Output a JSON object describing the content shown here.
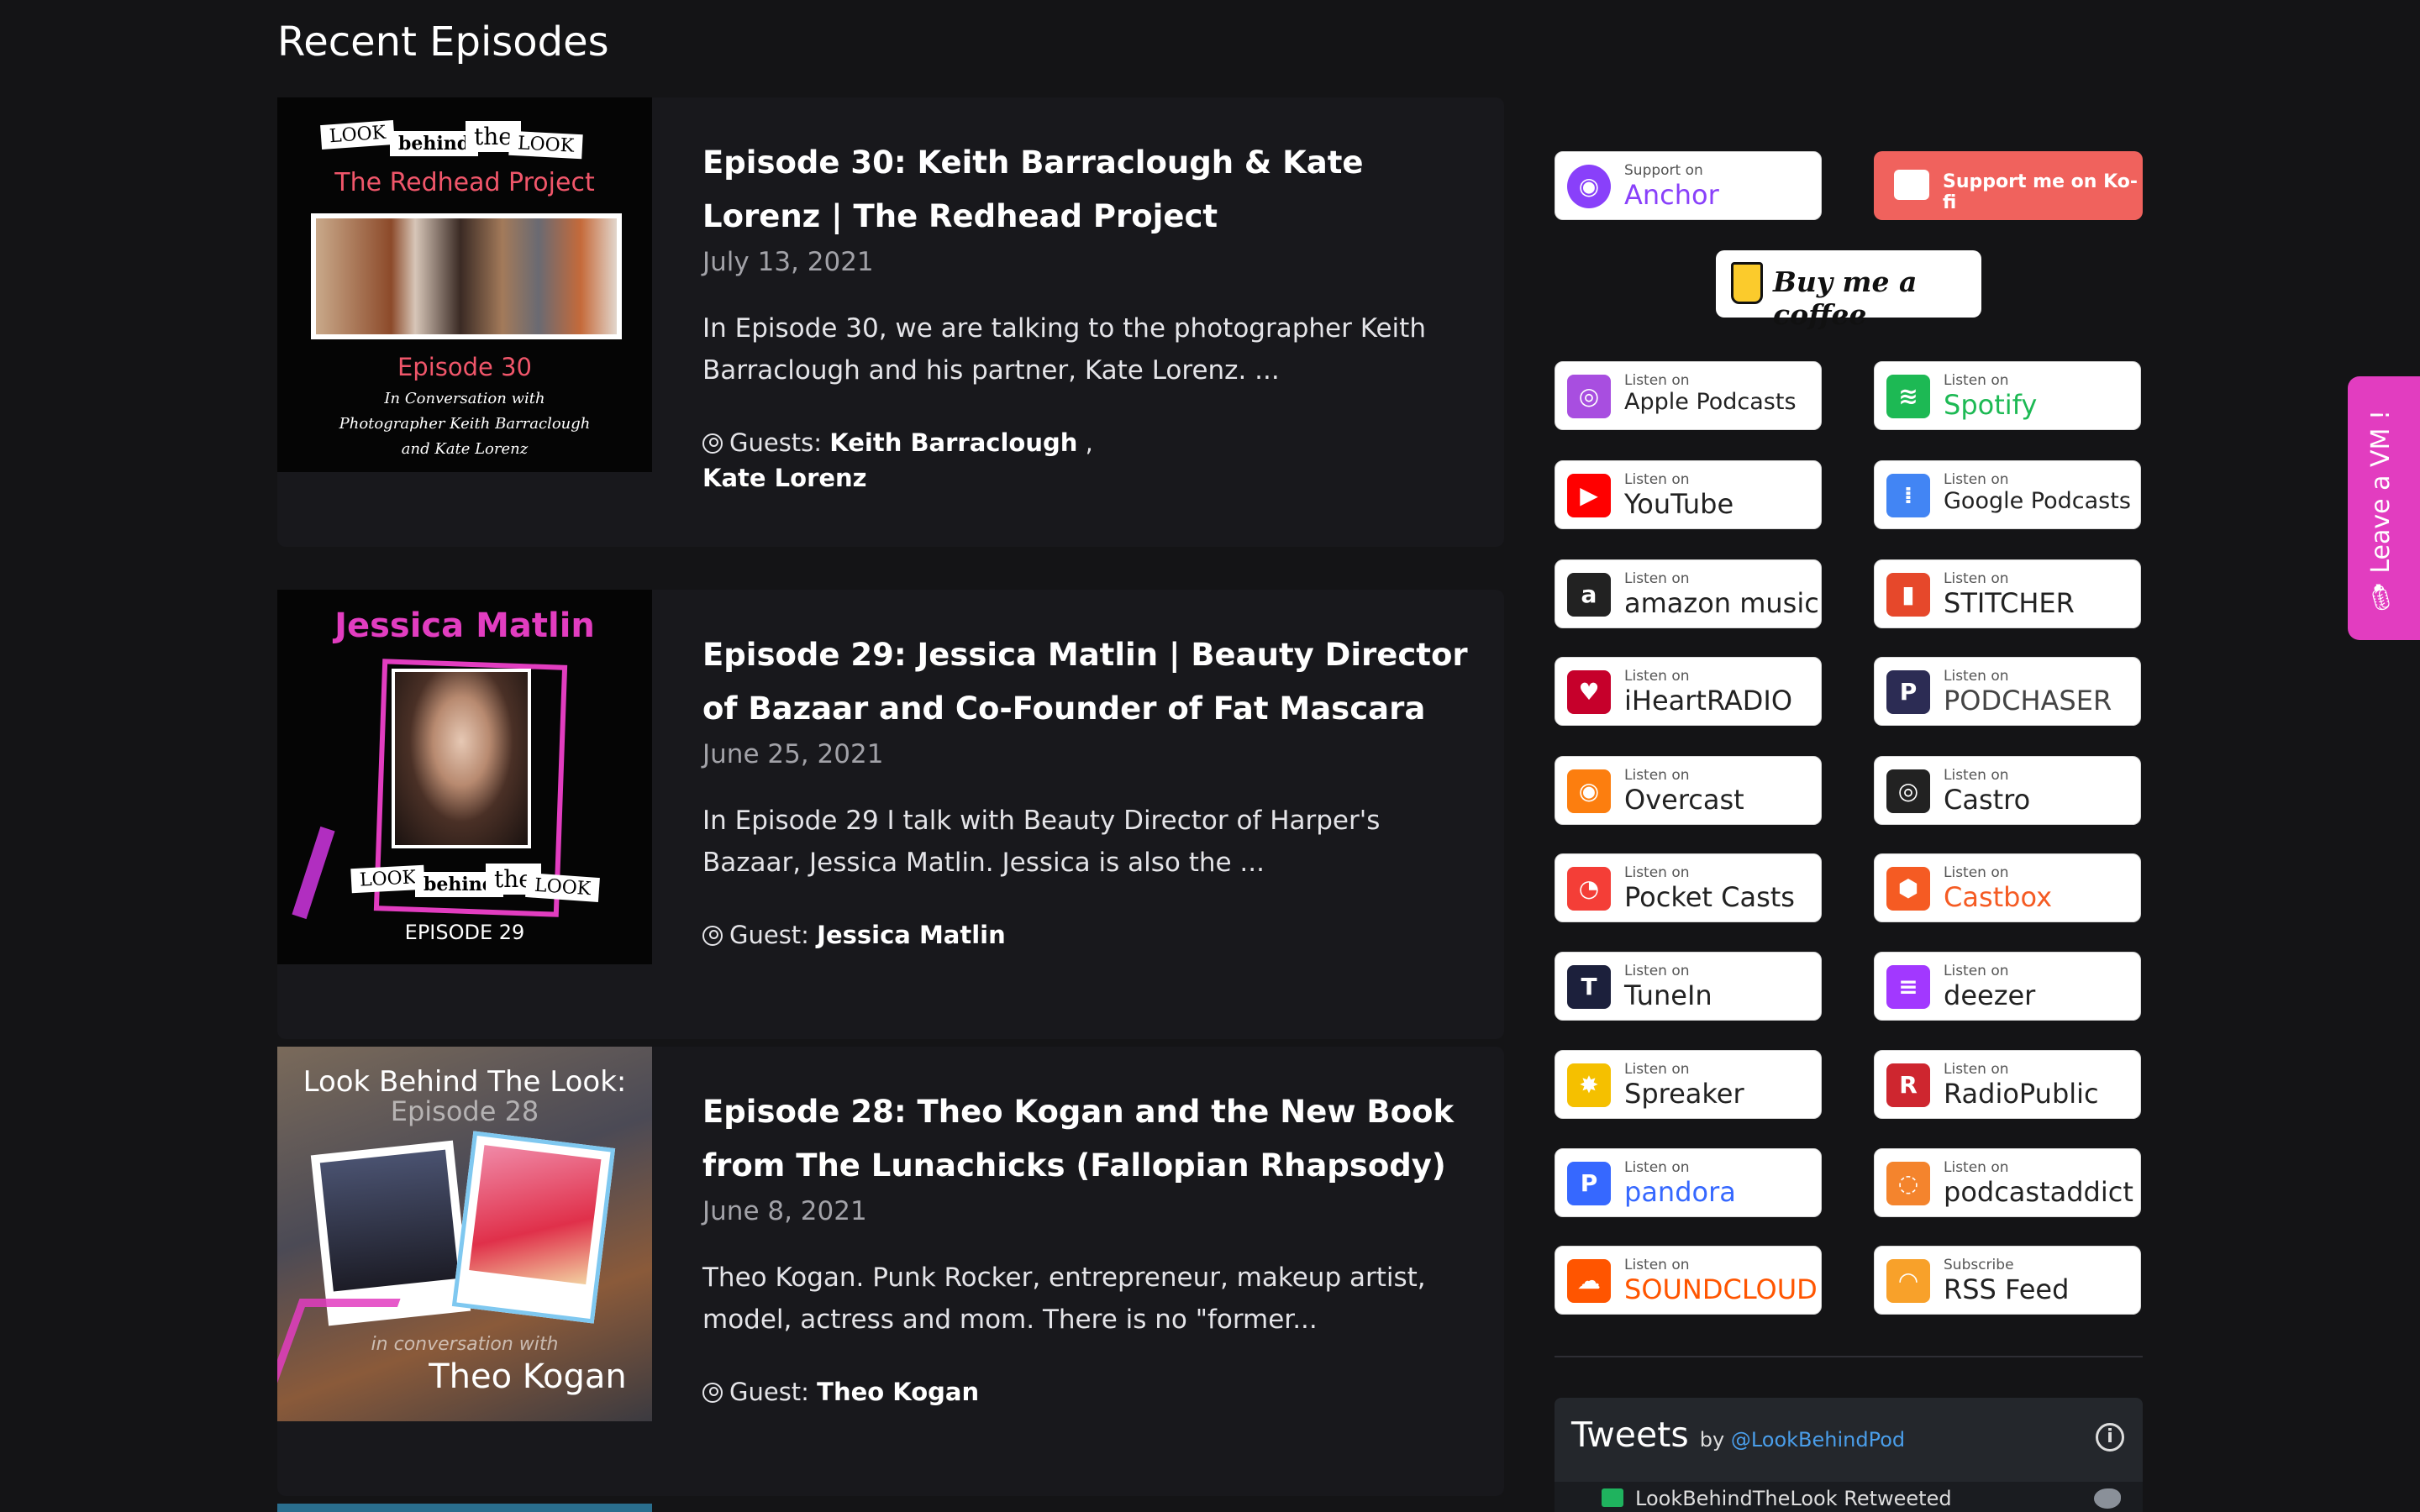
{
  "section_title": "Recent Episodes",
  "episodes": [
    {
      "title": "Episode 30: Keith Barraclough & Kate Lorenz | The Redhead Project",
      "date": "July 13, 2021",
      "excerpt": "In Episode 30, we are talking to the photographer Keith Barraclough and his partner, Kate Lorenz. ...",
      "guests_label": "Guests:",
      "guests": [
        "Keith Barraclough",
        "Kate Lorenz"
      ],
      "thumb": {
        "brand_words": [
          "LOOK",
          "behind",
          "the",
          "LOOK"
        ],
        "heading": "The Redhead Project",
        "episode": "Episode 30",
        "caption_lines": [
          "In Conversation with",
          "Photographer Keith Barraclough",
          "and Kate Lorenz"
        ]
      }
    },
    {
      "title": "Episode 29: Jessica Matlin | Beauty Director of Bazaar and Co-Founder of Fat Mascara",
      "date": "June 25, 2021",
      "excerpt": "In Episode 29 I talk with Beauty Director of Harper's Bazaar, Jessica Matlin.  Jessica is also the ...",
      "guests_label": "Guest:",
      "guests": [
        "Jessica Matlin"
      ],
      "thumb": {
        "heading": "Jessica Matlin",
        "brand_words": [
          "LOOK",
          "behind",
          "the",
          "LOOK"
        ],
        "episode": "EPISODE 29"
      }
    },
    {
      "title": "Episode 28: Theo Kogan and the New Book from The Lunachicks (Fallopian Rhapsody)",
      "date": "June 8, 2021",
      "excerpt": "Theo Kogan.  Punk Rocker, entrepreneur, makeup artist, model, actress and mom.  There is no \"former...",
      "guests_label": "Guest:",
      "guests": [
        "Theo Kogan"
      ],
      "thumb": {
        "heading": "Look Behind The Look:",
        "episode": "Episode 28",
        "subheading": "in conversation with",
        "name": "Theo Kogan"
      }
    }
  ],
  "support": {
    "anchor": {
      "small": "Support on",
      "big": "Anchor",
      "color": "#8940fa"
    },
    "kofi": {
      "label": "Support me on Ko-fi",
      "color": "#f0625d"
    },
    "bmc": {
      "label": "Buy me a coffee"
    }
  },
  "platforms": [
    {
      "small": "Listen on",
      "big": "Apple Podcasts",
      "color": "#a84ee0",
      "glyph": "◎"
    },
    {
      "small": "Listen on",
      "big": "Spotify",
      "color": "#1db954",
      "glyph": "≋",
      "big_color": "#1db954"
    },
    {
      "small": "Listen on",
      "big": "YouTube",
      "color": "#ff0000",
      "glyph": "▶"
    },
    {
      "small": "Listen on",
      "big": "Google Podcasts",
      "color": "#4285f4",
      "glyph": "⁞"
    },
    {
      "small": "Listen on",
      "big": "amazon music",
      "color": "#222222",
      "glyph": "a"
    },
    {
      "small": "Listen on",
      "big": "STITCHER",
      "color": "#e6482b",
      "glyph": "▮"
    },
    {
      "small": "Listen on",
      "big": "iHeartRADIO",
      "color": "#c6002b",
      "glyph": "♥"
    },
    {
      "small": "Listen on",
      "big": "PODCHASER",
      "color": "#2c2c54",
      "glyph": "P",
      "big_color": "#444"
    },
    {
      "small": "Listen on",
      "big": "Overcast",
      "color": "#fc7e0f",
      "glyph": "◉"
    },
    {
      "small": "Listen on",
      "big": "Castro",
      "color": "#222222",
      "glyph": "◎"
    },
    {
      "small": "Listen on",
      "big": "Pocket Casts",
      "color": "#f43e37",
      "glyph": "◔"
    },
    {
      "small": "Listen on",
      "big": "Castbox",
      "color": "#f55b23",
      "glyph": "⬢",
      "big_color": "#f55b23"
    },
    {
      "small": "Listen on",
      "big": "TuneIn",
      "color": "#1c203c",
      "glyph": "T"
    },
    {
      "small": "Listen on",
      "big": "deezer",
      "color": "#a238ff",
      "glyph": "≡"
    },
    {
      "small": "Listen on",
      "big": "Spreaker",
      "color": "#f5c000",
      "glyph": "✸"
    },
    {
      "small": "Listen on",
      "big": "RadioPublic",
      "color": "#ce262f",
      "glyph": "R"
    },
    {
      "small": "Listen on",
      "big": "pandora",
      "color": "#3668ff",
      "glyph": "P",
      "big_color": "#3668ff"
    },
    {
      "small": "Listen on",
      "big": "podcastaddict",
      "color": "#f4842d",
      "glyph": "◌"
    },
    {
      "small": "Listen on",
      "big": "SOUNDCLOUD",
      "color": "#ff5500",
      "glyph": "☁",
      "big_color": "#ff5500"
    },
    {
      "small": "Subscribe",
      "big": "RSS Feed",
      "color": "#f8a12a",
      "glyph": "◠"
    }
  ],
  "tweets": {
    "title": "Tweets",
    "by": "by",
    "handle": "@LookBehindPod",
    "info": "i",
    "retweet_text": "LookBehindTheLook Retweeted"
  },
  "voicemail": {
    "label": "🎙 Leave a VM !",
    "color": "#e23dc0"
  }
}
